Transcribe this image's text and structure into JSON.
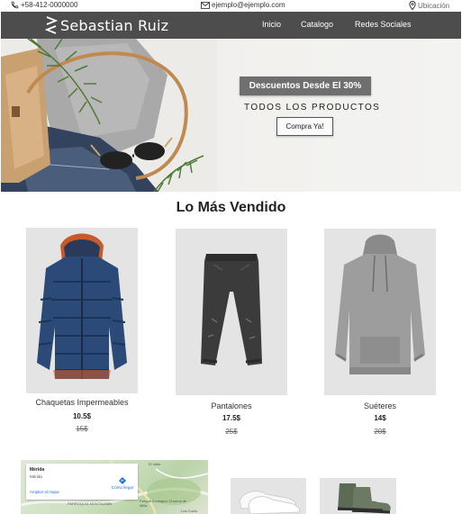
{
  "topbar": {
    "phone": "+58-412-0000000",
    "email": "ejemplo@ejemplo.com",
    "location": "Ubicación"
  },
  "nav": {
    "brand": "Sebastian Ruiz",
    "links": [
      "Inicio",
      "Catalogo",
      "Redes Sociales"
    ]
  },
  "hero": {
    "badge": "Descuentos Desde El 30%",
    "subtitle": "TODOS LOS PRODUCTOS",
    "cta": "Compra Ya!"
  },
  "bestsellers": {
    "title": "Lo Más Vendido",
    "products": [
      {
        "name": "Chaquetas Impermeables",
        "price": "10.5$",
        "old_price": "15$"
      },
      {
        "name": "Pantalones",
        "price": "17.5$",
        "old_price": "25$"
      },
      {
        "name": "Suéteres",
        "price": "14$",
        "old_price": "20$"
      }
    ]
  },
  "map": {
    "title": "Mérida",
    "subtitle": "Mérida",
    "directions": "Cómo llegar",
    "enlarge": "Ampliar el mapa",
    "labels": [
      "El Valle",
      "PARROQUIA MONTALBÁN",
      "Parque Zoológico Chorros de Milla",
      "Los Curos"
    ]
  },
  "colors": {
    "nav_bg": "#4d4d4d",
    "badge_bg": "#6f6f6f",
    "product_bg": "#e4e4e4"
  }
}
